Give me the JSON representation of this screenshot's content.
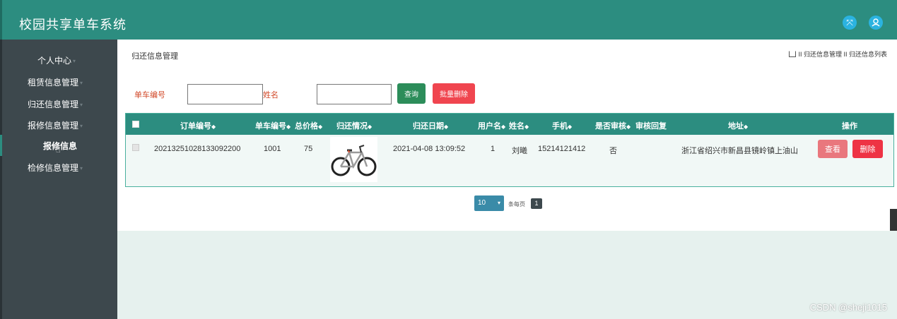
{
  "app": {
    "title": "校园共享单车系统"
  },
  "header_icons": [
    "expand-icon",
    "user-icon"
  ],
  "sidebar": {
    "items": [
      {
        "label": "个人中心",
        "submenu": true
      },
      {
        "label": "租赁信息管理",
        "submenu": true
      },
      {
        "label": "归还信息管理",
        "submenu": true
      },
      {
        "label": "报修信息管理",
        "submenu": true
      },
      {
        "label": "报修信息",
        "submenu": false,
        "active": true
      },
      {
        "label": "检修信息管理",
        "submenu": true
      }
    ]
  },
  "page": {
    "title": "归还信息管理",
    "breadcrumb": "II 归还信息管理 II 归还信息列表"
  },
  "search": {
    "bike_label": "单车编号",
    "bike_value": "",
    "name_label": "姓名",
    "name_value": "",
    "query_button": "查询",
    "batch_delete_button": "批量删除"
  },
  "table": {
    "headers": [
      "订单编号",
      "单车编号",
      "总价格",
      "归还情况",
      "归还日期",
      "用户名",
      "姓名",
      "手机",
      "是否审核",
      "审核回复",
      "地址",
      "操作"
    ],
    "rows": [
      {
        "order_no": "20213251028133092200",
        "bike_no": "1001",
        "price": "75",
        "image": "bicycle",
        "date": "2021-04-08 13:09:52",
        "username": "1",
        "name": "刘曦",
        "phone": "15214121412",
        "audited": "否",
        "reply": "",
        "address": "浙江省绍兴市新昌县镜岭镇上油山",
        "view_button": "查看",
        "delete_button": "删除"
      }
    ]
  },
  "pagination": {
    "page_size": "10",
    "per_page_label": "条每页",
    "current_page": "1"
  },
  "watermark": "CSDN @sheji1015",
  "colors": {
    "header": "#2c8d80",
    "sidebar": "#3d484d",
    "content_bg": "#e6f1ee",
    "query_button": "#2c8d5a",
    "delete_button": "#ee3344",
    "view_button": "#e9777d"
  }
}
